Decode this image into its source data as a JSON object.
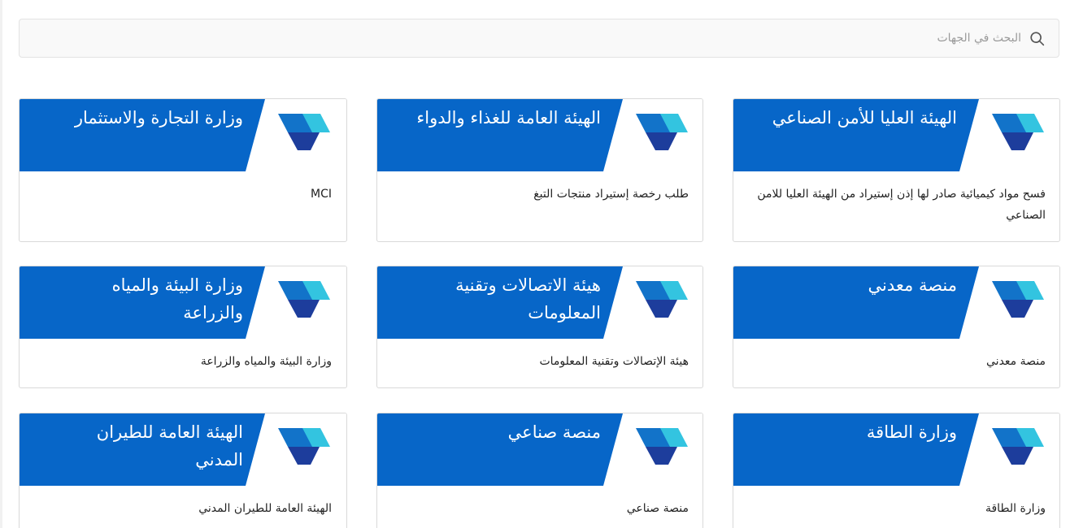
{
  "search": {
    "placeholder": "البحث في الجهات",
    "icon": "search-icon"
  },
  "colors": {
    "banner_blue": "#0766c8",
    "logo_cyan": "#33c4e0",
    "logo_blue": "#1273c9",
    "logo_navy": "#1d3d9c"
  },
  "cards": [
    {
      "title": "الهيئة العليا للأمن الصناعي",
      "description": "فسح مواد كيميائية صادر لها إذن إستيراد من الهيئة العليا للامن الصناعي",
      "logo": "platform-logo-icon"
    },
    {
      "title": "الهيئة العامة للغذاء والدواء",
      "description": "طلب رخصة إستيراد منتجات التبغ",
      "logo": "platform-logo-icon"
    },
    {
      "title": "وزارة التجارة والاستثمار",
      "description": "MCI",
      "logo": "platform-logo-icon"
    },
    {
      "title": "منصة معدني",
      "description": "منصة معدني",
      "logo": "platform-logo-icon"
    },
    {
      "title": "هيئة الاتصالات وتقنية المعلومات",
      "description": "هيئة الإتصالات وتقنية المعلومات",
      "logo": "platform-logo-icon"
    },
    {
      "title": "وزارة البيئة والمياه والزراعة",
      "description": "وزارة البيئة والمياه والزراعة",
      "logo": "platform-logo-icon"
    },
    {
      "title": "وزارة الطاقة",
      "description": "وزارة الطاقة",
      "logo": "platform-logo-icon"
    },
    {
      "title": "منصة صناعي",
      "description": "منصة صناعي",
      "logo": "platform-logo-icon"
    },
    {
      "title": "الهيئة العامة للطيران المدني",
      "description": "الهيئة العامة للطيران المدني",
      "logo": "platform-logo-icon"
    }
  ]
}
